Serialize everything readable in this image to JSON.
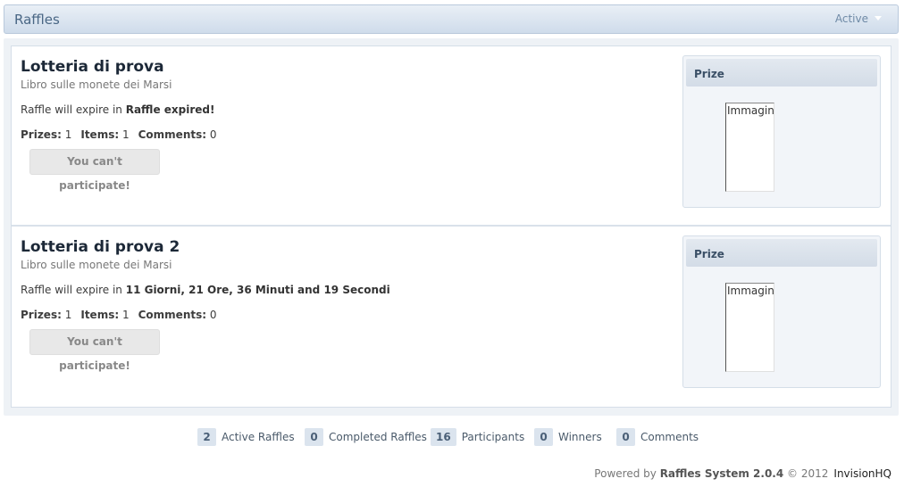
{
  "header": {
    "title": "Raffles",
    "filter_label": "Active"
  },
  "raffles": [
    {
      "title": "Lotteria di prova",
      "subtitle": "Libro sulle monete dei Marsi",
      "expire_prefix": "Raffle will expire in",
      "expire_value": "Raffle expired!",
      "prizes_label": "Prizes:",
      "prizes_value": "1",
      "items_label": "Items:",
      "items_value": "1",
      "comments_label": "Comments:",
      "comments_value": "0",
      "button_label": "You can't participate!",
      "prize_heading": "Prize",
      "prize_image_alt": "Immagine"
    },
    {
      "title": "Lotteria di prova 2",
      "subtitle": "Libro sulle monete dei Marsi",
      "expire_prefix": "Raffle will expire in",
      "expire_value": "11 Giorni, 21 Ore, 36 Minuti and 19 Secondi",
      "prizes_label": "Prizes:",
      "prizes_value": "1",
      "items_label": "Items:",
      "items_value": "1",
      "comments_label": "Comments:",
      "comments_value": "0",
      "button_label": "You can't participate!",
      "prize_heading": "Prize",
      "prize_image_alt": "Immagine"
    }
  ],
  "stats": [
    {
      "value": "2",
      "label": "Active Raffles"
    },
    {
      "value": "0",
      "label": "Completed Raffles"
    },
    {
      "value": "16",
      "label": "Participants"
    },
    {
      "value": "0",
      "label": "Winners"
    },
    {
      "value": "0",
      "label": "Comments"
    }
  ],
  "footer": {
    "prefix": "Powered by",
    "product": "Raffles System 2.0.4",
    "copyright": "© 2012",
    "company": "InvisionHQ"
  },
  "colors": {
    "header_bg": "#cfdceb",
    "title": "#1c2837",
    "badge_bg": "#dbe4ee"
  }
}
